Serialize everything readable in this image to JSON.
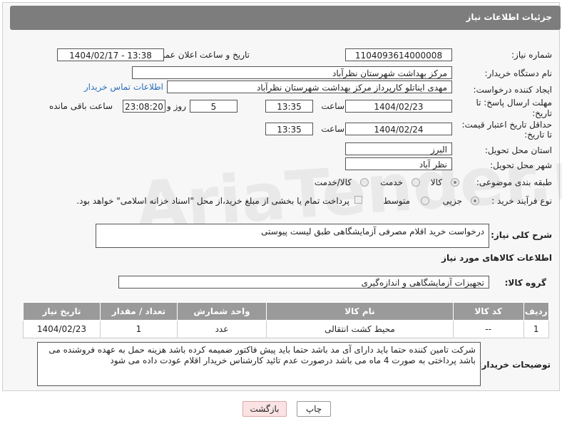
{
  "header": {
    "title": "جزئیات اطلاعات نیاز"
  },
  "form": {
    "need_number_label": "شماره نیاز:",
    "need_number": "1104093614000008",
    "announce_label": "تاریخ و ساعت اعلان عمومی:",
    "announce_value": "1404/02/17 - 13:38",
    "buyer_org_label": "نام دستگاه خریدار:",
    "buyer_org": "مرکز بهداشت شهرستان نظرآباد",
    "creator_label": "ایجاد کننده درخواست:",
    "creator": "مهدی ایناتلو کارپرداز مرکز بهداشت شهرستان نظرآباد",
    "contact_link": "اطلاعات تماس خریدار",
    "deadline_label_1": "مهلت ارسال پاسخ: تا",
    "deadline_label_2": "تاریخ:",
    "deadline_date": "1404/02/23",
    "time_label": "ساعت",
    "deadline_time": "13:35",
    "days_value": "5",
    "days_label": "روز و",
    "remaining_time": "23:08:20",
    "remaining_label": "ساعت باقی مانده",
    "price_validity_label_1": "حداقل تاریخ اعتبار قیمت:",
    "price_validity_label_2": "تا تاریخ:",
    "price_validity_date": "1404/02/24",
    "price_validity_time": "13:35",
    "province_label": "استان محل تحویل:",
    "province": "البرز",
    "city_label": "شهر محل تحویل:",
    "city": "نظر آباد",
    "category_label": "طبقه بندی موضوعی:",
    "category_options": [
      "کالا",
      "خدمت",
      "کالا/خدمت"
    ],
    "process_label": "نوع فرآیند خرید :",
    "process_options": [
      "جزیی",
      "متوسط"
    ],
    "payment_note": "پرداخت تمام یا بخشی از مبلغ خرید،از محل \"اسناد خزانه اسلامی\" خواهد بود.",
    "description_label": "شرح کلی نیاز:",
    "description": "درخواست خرید اقلام مصرفی آزمایشگاهی طبق لیست پیوستی",
    "goods_info_title": "اطلاعات کالاهای مورد نیاز",
    "goods_group_label": "گروه کالا:",
    "goods_group": "تجهیزات آزمایشگاهی و اندازه‌گیری",
    "buyer_notes_label": "توضیحات خریدار:",
    "buyer_notes": "شرکت تامین کننده حتما باید دارای آی مد باشد حتما باید پیش فاکتور ضمیمه کرده باشد هزینه حمل به عهده فروشنده می باشد پرداختی به صورت 4 ماه می باشد درصورت عدم تائید کارشناس خریدار اقلام عودت داده می شود"
  },
  "table": {
    "headers": [
      "ردیف",
      "کد کالا",
      "نام کالا",
      "واحد شمارش",
      "تعداد / مقدار",
      "تاریخ نیاز"
    ],
    "rows": [
      [
        "1",
        "--",
        "محیط کشت انتقالی",
        "عدد",
        "1",
        "1404/02/23"
      ]
    ]
  },
  "buttons": {
    "print": "چاپ",
    "back": "بازگشت"
  },
  "watermark": "AriaTender.net"
}
